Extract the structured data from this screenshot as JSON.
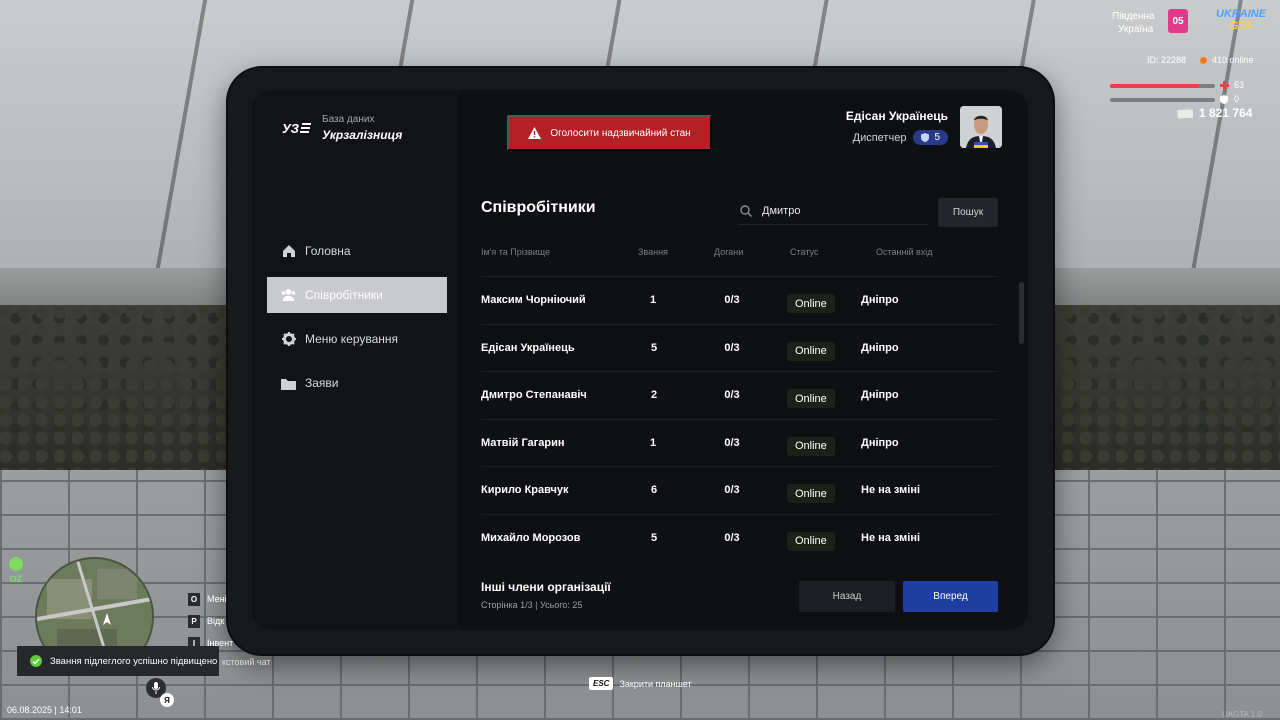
{
  "app": {
    "brand_subtitle": "База даних",
    "brand_title": "Укрзалізниця",
    "alarm_label": "Оголосити надзвичайний стан"
  },
  "user": {
    "name": "Едісан Українець",
    "role": "Диспетчер",
    "rank": "5"
  },
  "sidebar": {
    "items": [
      {
        "label": "Головна",
        "icon": "home-icon",
        "active": false
      },
      {
        "label": "Співробітники",
        "icon": "users-icon",
        "active": true
      },
      {
        "label": "Меню керування",
        "icon": "gear-icon",
        "active": false
      },
      {
        "label": "Заяви",
        "icon": "folder-icon",
        "active": false
      }
    ]
  },
  "main": {
    "title": "Співробітники",
    "search": {
      "value": "Дмитро",
      "placeholder": "",
      "button": "Пошук"
    },
    "columns": [
      "Ім'я та Прізвище",
      "Звання",
      "Догани",
      "Статус",
      "Останній вхід"
    ],
    "rows": [
      {
        "name": "Максим Чорніючий",
        "rank": "1",
        "warnings": "0/3",
        "status": "Online",
        "last": "Дніпро"
      },
      {
        "name": "Едісан Українець",
        "rank": "5",
        "warnings": "0/3",
        "status": "Online",
        "last": "Дніпро"
      },
      {
        "name": "Дмитро Степанавіч",
        "rank": "2",
        "warnings": "0/3",
        "status": "Online",
        "last": "Дніпро"
      },
      {
        "name": "Матвій Гагарин",
        "rank": "1",
        "warnings": "0/3",
        "status": "Online",
        "last": "Дніпро"
      },
      {
        "name": "Кирило Кравчук",
        "rank": "6",
        "warnings": "0/3",
        "status": "Online",
        "last": "Не на зміні"
      },
      {
        "name": "Михайло Морозов",
        "rank": "5",
        "warnings": "0/3",
        "status": "Online",
        "last": "Не на зміні"
      }
    ],
    "footer": {
      "title": "Інші члени організації",
      "pagination": "Сторінка 1/3 | Усього: 25",
      "back_label": "Назад",
      "next_label": "Вперед"
    }
  },
  "hud": {
    "region_line1": "Південна",
    "region_line2": "Україна",
    "region_badge": "05",
    "logo_line1": "UKRAINE",
    "logo_line2": "GTA",
    "player_id": "ID: 22288",
    "online": "410 online",
    "health": "63",
    "health_fraction": 0.85,
    "armor": "0",
    "money": "1 821 764",
    "zone": "GZ",
    "keys": [
      {
        "key": "O",
        "label": "Мені"
      },
      {
        "key": "P",
        "label": "Відк"
      },
      {
        "key": "I",
        "label": "Інвент"
      }
    ],
    "notification": "Звання підлеглого успішно підвищено",
    "chat_hint": "кстовий чат",
    "lang": "Я",
    "datetime": "06.08.2025 | 14:01",
    "esc_key": "ESC",
    "esc_label": "Закрити планшет",
    "version": "UAGTA 1.0"
  },
  "colors": {
    "accent_red": "#b32026",
    "accent_blue": "#1f3fa0",
    "status_green": "#8fd65b",
    "active_nav": "#c9cacd"
  }
}
